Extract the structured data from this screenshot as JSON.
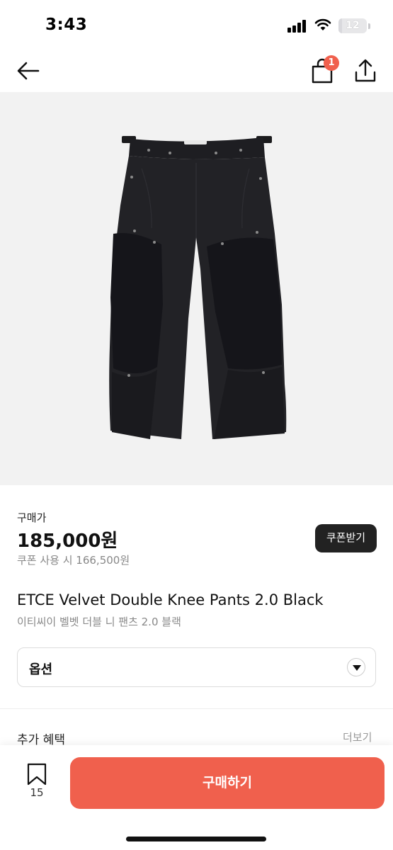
{
  "status_bar": {
    "time": "3:43",
    "battery": "12",
    "battery_level": 0.12
  },
  "nav": {
    "cart_badge": "1",
    "icons": [
      "back-arrow-icon",
      "shopping-bag-icon",
      "share-icon"
    ]
  },
  "product": {
    "image_icon": "black-velvet-double-knee-pants-photo",
    "price_label": "구매가",
    "price": "185,000원",
    "coupon_price": "쿠폰 사용 시 166,500원",
    "coupon_button": "쿠폰받기",
    "title_en": "ETCE Velvet Double Knee Pants 2.0 Black",
    "title_ko": "이티씨이 벨벳 더블 니 팬츠 2.0 블랙"
  },
  "option": {
    "label": "옵션"
  },
  "benefits": {
    "label": "추가 혜택",
    "more": "더보기"
  },
  "bottom": {
    "bookmark_count": "15",
    "buy_label": "구매하기"
  },
  "colors": {
    "accent": "#f0604d",
    "dark_button": "#222222"
  }
}
